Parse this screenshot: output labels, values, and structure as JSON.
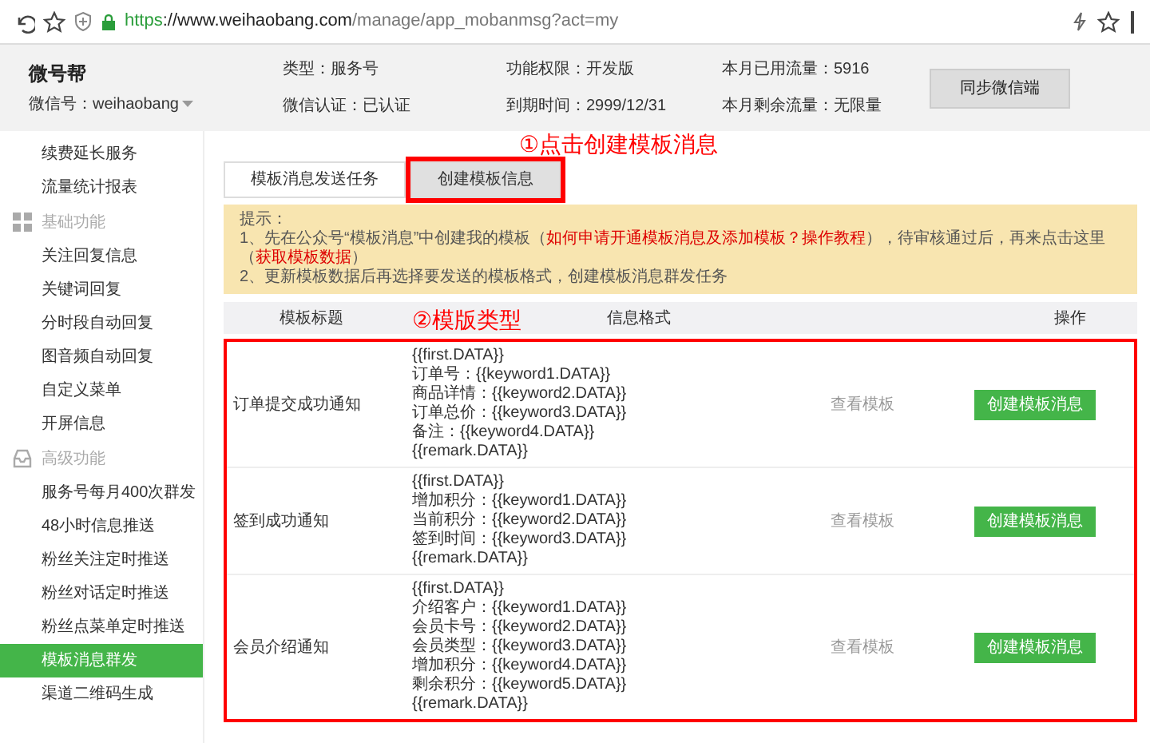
{
  "browser": {
    "url_scheme": "https",
    "url_rest": "://www.weihaobang.com/manage/app_mobanmsg?act=my"
  },
  "header": {
    "title": "微号帮",
    "account": "微信号：weihaobang",
    "info": [
      {
        "label": "类型：",
        "value": "服务号"
      },
      {
        "label": "微信认证：",
        "value": "已认证"
      },
      {
        "label": "功能权限：",
        "value": "开发版"
      },
      {
        "label": "到期时间：",
        "value": "2999/12/31"
      },
      {
        "label": "本月已用流量：",
        "value": "5916"
      },
      {
        "label": "本月剩余流量：",
        "value": "无限量"
      }
    ],
    "button": "同步微信端"
  },
  "sidebar": {
    "items": [
      {
        "kind": "item",
        "label": "续费延长服务",
        "selected": false
      },
      {
        "kind": "item",
        "label": "流量统计报表",
        "selected": false
      },
      {
        "kind": "group",
        "label": "基础功能"
      },
      {
        "kind": "item",
        "label": "关注回复信息",
        "selected": false
      },
      {
        "kind": "item",
        "label": "关键词回复",
        "selected": false
      },
      {
        "kind": "item",
        "label": "分时段自动回复",
        "selected": false
      },
      {
        "kind": "item",
        "label": "图音频自动回复",
        "selected": false
      },
      {
        "kind": "item",
        "label": "自定义菜单",
        "selected": false
      },
      {
        "kind": "item",
        "label": "开屏信息",
        "selected": false
      },
      {
        "kind": "group",
        "label": "高级功能"
      },
      {
        "kind": "item",
        "label": "服务号每月400次群发",
        "selected": false
      },
      {
        "kind": "item",
        "label": "48小时信息推送",
        "selected": false
      },
      {
        "kind": "item",
        "label": "粉丝关注定时推送",
        "selected": false
      },
      {
        "kind": "item",
        "label": "粉丝对话定时推送",
        "selected": false
      },
      {
        "kind": "item",
        "label": "粉丝点菜单定时推送",
        "selected": false
      },
      {
        "kind": "item",
        "label": "模板消息群发",
        "selected": true
      },
      {
        "kind": "item",
        "label": "渠道二维码生成",
        "selected": false
      }
    ]
  },
  "tabs": [
    {
      "label": "模板消息发送任务",
      "selected": true,
      "highlighted": false
    },
    {
      "label": "创建模板信息",
      "selected": false,
      "highlighted": true
    }
  ],
  "annotations": [
    "①点击创建模板消息",
    "②模版类型"
  ],
  "notice": {
    "title": "提示：",
    "lines": [
      [
        {
          "text": "1、先在公众号“模板消息”中创建我的模板（",
          "link": false
        },
        {
          "text": "如何申请开通模板消息及添加模板？操作教程",
          "link": true
        },
        {
          "text": "），待审核通过后，再来点击这里（",
          "link": false
        },
        {
          "text": "获取模板数据",
          "link": true
        },
        {
          "text": "）",
          "link": false
        }
      ],
      [
        {
          "text": "2、更新模板数据后再选择要发送的模板格式，创建模板消息群发任务",
          "link": false
        }
      ]
    ]
  },
  "table": {
    "columns": [
      "模板标题",
      "信息格式",
      "操作"
    ],
    "rows": [
      {
        "title": "订单提交成功通知",
        "format": [
          "{{first.DATA}}",
          "订单号：{{keyword1.DATA}}",
          "商品详情：{{keyword2.DATA}}",
          "订单总价：{{keyword3.DATA}}",
          "备注：{{keyword4.DATA}}",
          "{{remark.DATA}}"
        ],
        "view": "查看模板",
        "action": "创建模板消息"
      },
      {
        "title": "签到成功通知",
        "format": [
          "{{first.DATA}}",
          "增加积分：{{keyword1.DATA}}",
          "当前积分：{{keyword2.DATA}}",
          "签到时间：{{keyword3.DATA}}",
          "{{remark.DATA}}"
        ],
        "view": "查看模板",
        "action": "创建模板消息"
      },
      {
        "title": "会员介绍通知",
        "format": [
          "{{first.DATA}}",
          "介绍客户：{{keyword1.DATA}}",
          "会员卡号：{{keyword2.DATA}}",
          "会员类型：{{keyword3.DATA}}",
          "增加积分：{{keyword4.DATA}}",
          "剩余积分：{{keyword5.DATA}}",
          "{{remark.DATA}}"
        ],
        "view": "查看模板",
        "action": "创建模板消息"
      }
    ]
  }
}
